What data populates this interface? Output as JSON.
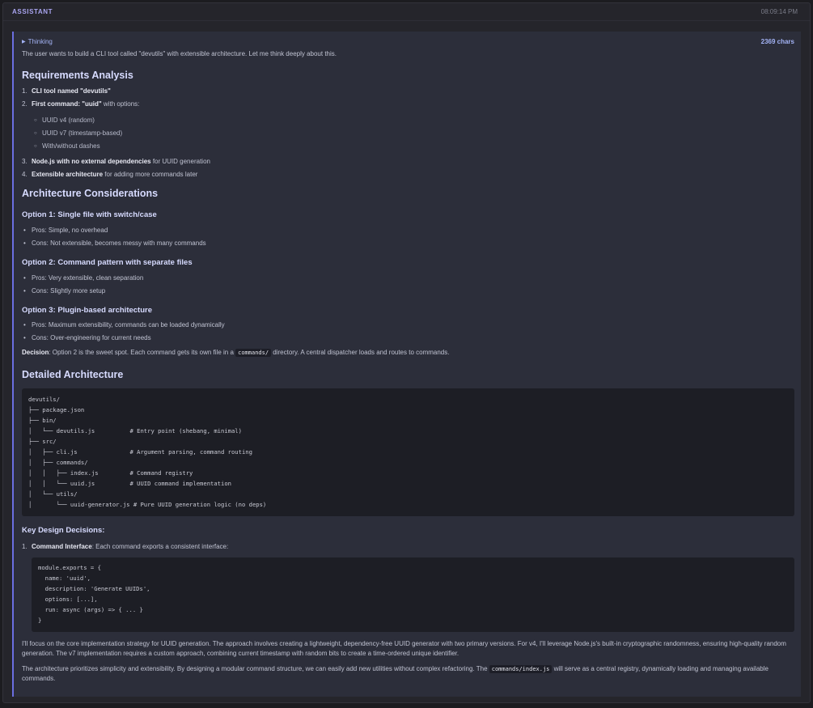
{
  "header": {
    "role": "ASSISTANT",
    "time": "08:09:14 PM"
  },
  "thinking": {
    "toggle_label": "Thinking",
    "toggle_icon": "caret-right-icon",
    "char_count": "2369 chars",
    "intro": "The user wants to build a CLI tool called \"devutils\" with extensible architecture. Let me think deeply about this.",
    "req_heading": "Requirements Analysis",
    "req_items": [
      {
        "num": "1.",
        "bold": "CLI tool named \"devutils\"",
        "rest": ""
      },
      {
        "num": "2.",
        "bold": "First command: \"uuid\"",
        "rest": " with options:"
      },
      {
        "num": "3.",
        "bold": "Node.js with no external dependencies",
        "rest": " for UUID generation"
      },
      {
        "num": "4.",
        "bold": "Extensible architecture",
        "rest": " for adding more commands later"
      }
    ],
    "uuid_options": [
      "UUID v4 (random)",
      "UUID v7 (timestamp-based)",
      "With/without dashes"
    ],
    "arch_heading": "Architecture Considerations",
    "options": [
      {
        "title": "Option 1: Single file with switch/case",
        "pros": "Pros: Simple, no overhead",
        "cons": "Cons: Not extensible, becomes messy with many commands"
      },
      {
        "title": "Option 2: Command pattern with separate files",
        "pros": "Pros: Very extensible, clean separation",
        "cons": "Cons: Slightly more setup"
      },
      {
        "title": "Option 3: Plugin-based architecture",
        "pros": "Pros: Maximum extensibility, commands can be loaded dynamically",
        "cons": "Cons: Over-engineering for current needs"
      }
    ],
    "decision": {
      "label": "Decision",
      "before": ": Option 2 is the sweet spot. Each command gets its own file in a ",
      "code": "commands/",
      "after": " directory. A central dispatcher loads and routes to commands."
    },
    "detail_heading": "Detailed Architecture",
    "tree": "devutils/\n├── package.json\n├── bin/\n│   └── devutils.js          # Entry point (shebang, minimal)\n├── src/\n│   ├── cli.js               # Argument parsing, command routing\n│   ├── commands/\n│   │   ├── index.js         # Command registry\n│   │   └── uuid.js          # UUID command implementation\n│   └── utils/\n│       └── uuid-generator.js # Pure UUID generation logic (no deps)",
    "key_heading": "Key Design Decisions:",
    "key_item": {
      "num": "1.",
      "bold": "Command Interface",
      "rest": ": Each command exports a consistent interface:"
    },
    "code_block": "module.exports = {\n  name: 'uuid',\n  description: 'Generate UUIDs',\n  options: [...],\n  run: async (args) => { ... }\n}",
    "para1": "I'll focus on the core implementation strategy for UUID generation. The approach involves creating a lightweight, dependency-free UUID generator with two primary versions. For v4, I'll leverage Node.js's built-in cryptographic randomness, ensuring high-quality random generation. The v7 implementation requires a custom approach, combining current timestamp with random bits to create a time-ordered unique identifier.",
    "para2_before": "The architecture prioritizes simplicity and extensibility. By designing a modular command structure, we can easily add new utilities without complex refactoring. The ",
    "para2_code": "commands/index.js",
    "para2_after": " will serve as a central registry, dynamically loading and managing available commands."
  }
}
